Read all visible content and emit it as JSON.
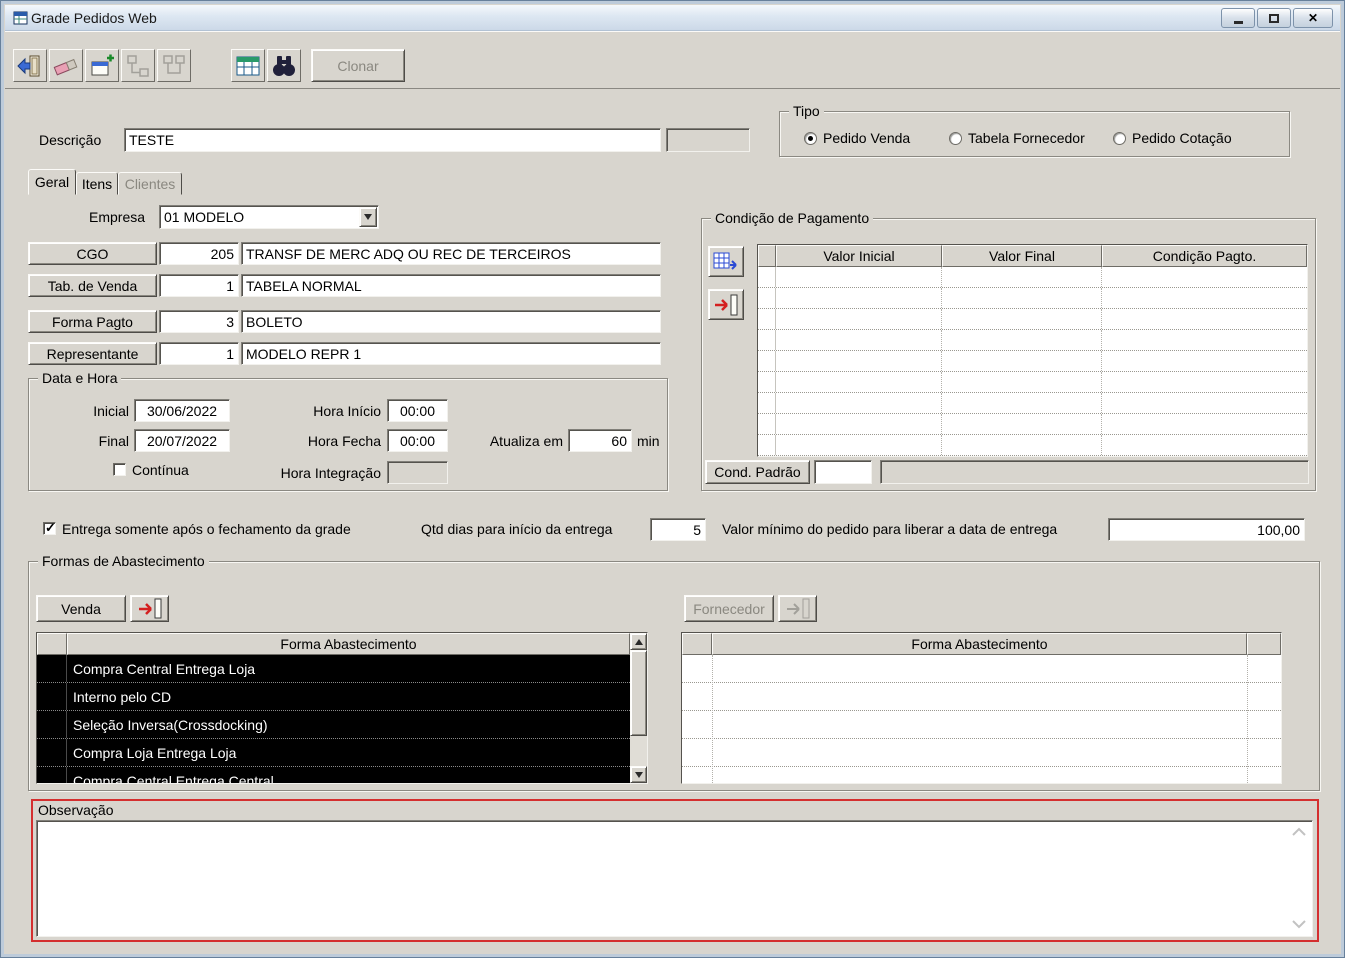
{
  "window": {
    "title": "Grade Pedidos Web"
  },
  "toolbar": {
    "clonar": "Clonar"
  },
  "descricao": {
    "label": "Descrição",
    "value": "TESTE"
  },
  "tipo": {
    "legend": "Tipo",
    "options": [
      {
        "label": "Pedido Venda",
        "selected": true
      },
      {
        "label": "Tabela Fornecedor",
        "selected": false
      },
      {
        "label": "Pedido Cotação",
        "selected": false
      }
    ]
  },
  "tabs": [
    {
      "label": "Geral",
      "active": true
    },
    {
      "label": "Itens",
      "active": false
    },
    {
      "label": "Clientes",
      "active": false
    }
  ],
  "empresa": {
    "label": "Empresa",
    "value": "01 MODELO"
  },
  "lookups": [
    {
      "button": "CGO",
      "code": "205",
      "desc": "TRANSF DE MERC ADQ OU REC DE TERCEIROS"
    },
    {
      "button": "Tab. de Venda",
      "code": "1",
      "desc": "TABELA NORMAL"
    },
    {
      "button": "Forma Pagto",
      "code": "3",
      "desc": "BOLETO"
    },
    {
      "button": "Representante",
      "code": "1",
      "desc": "MODELO REPR 1"
    }
  ],
  "data_hora": {
    "legend": "Data e Hora",
    "inicial_label": "Inicial",
    "inicial_value": "30/06/2022",
    "hora_inicio_label": "Hora Início",
    "hora_inicio_value": "00:00",
    "final_label": "Final",
    "final_value": "20/07/2022",
    "hora_fecha_label": "Hora Fecha",
    "hora_fecha_value": "00:00",
    "atualiza_label": "Atualiza em",
    "atualiza_value": "60",
    "atualiza_unit": "min",
    "continua_label": "Contínua",
    "continua_checked": false,
    "hora_integracao_label": "Hora Integração",
    "hora_integracao_value": ""
  },
  "condicao_pagamento": {
    "legend": "Condição de Pagamento",
    "columns": [
      "Valor Inicial",
      "Valor Final",
      "Condição Pagto."
    ],
    "cond_padrao_label": "Cond. Padrão",
    "cond_padrao_code": "",
    "cond_padrao_desc": ""
  },
  "entrega": {
    "checkbox_label": "Entrega somente após o fechamento da grade",
    "checkbox_checked": true,
    "qtd_label": "Qtd dias para início da entrega",
    "qtd_value": "5",
    "valor_label": "Valor mínimo do pedido para liberar a data de entrega",
    "valor_value": "100,00"
  },
  "abastecimento": {
    "legend": "Formas de Abastecimento",
    "venda_button": "Venda",
    "fornecedor_button": "Fornecedor",
    "column_header": "Forma Abastecimento",
    "venda_rows": [
      "Compra Central Entrega Loja",
      "Interno pelo CD",
      "Seleção Inversa(Crossdocking)",
      "Compra Loja Entrega Loja",
      "Compra Central Entrega Central"
    ]
  },
  "observacao": {
    "label": "Observação",
    "value": ""
  },
  "icons": {
    "exit-icon": "door-with-blue-arrow",
    "eraser-icon": "pink-eraser",
    "add-icon": "box-with-plus",
    "structure-icon-1": "gray-nodes",
    "structure-icon-2": "gray-nodes",
    "grid-icon": "green-table",
    "search-icon": "binoculars",
    "insert-row-icon": "blue-grid-arrow",
    "remove-row-icon": "red-arrow-door"
  },
  "colors": {
    "highlight_red": "#d42f2f",
    "selection_bg": "#000000",
    "selection_text": "#ffffff",
    "window_bg": "#d8d5ce",
    "frame": "#bdcbda"
  }
}
